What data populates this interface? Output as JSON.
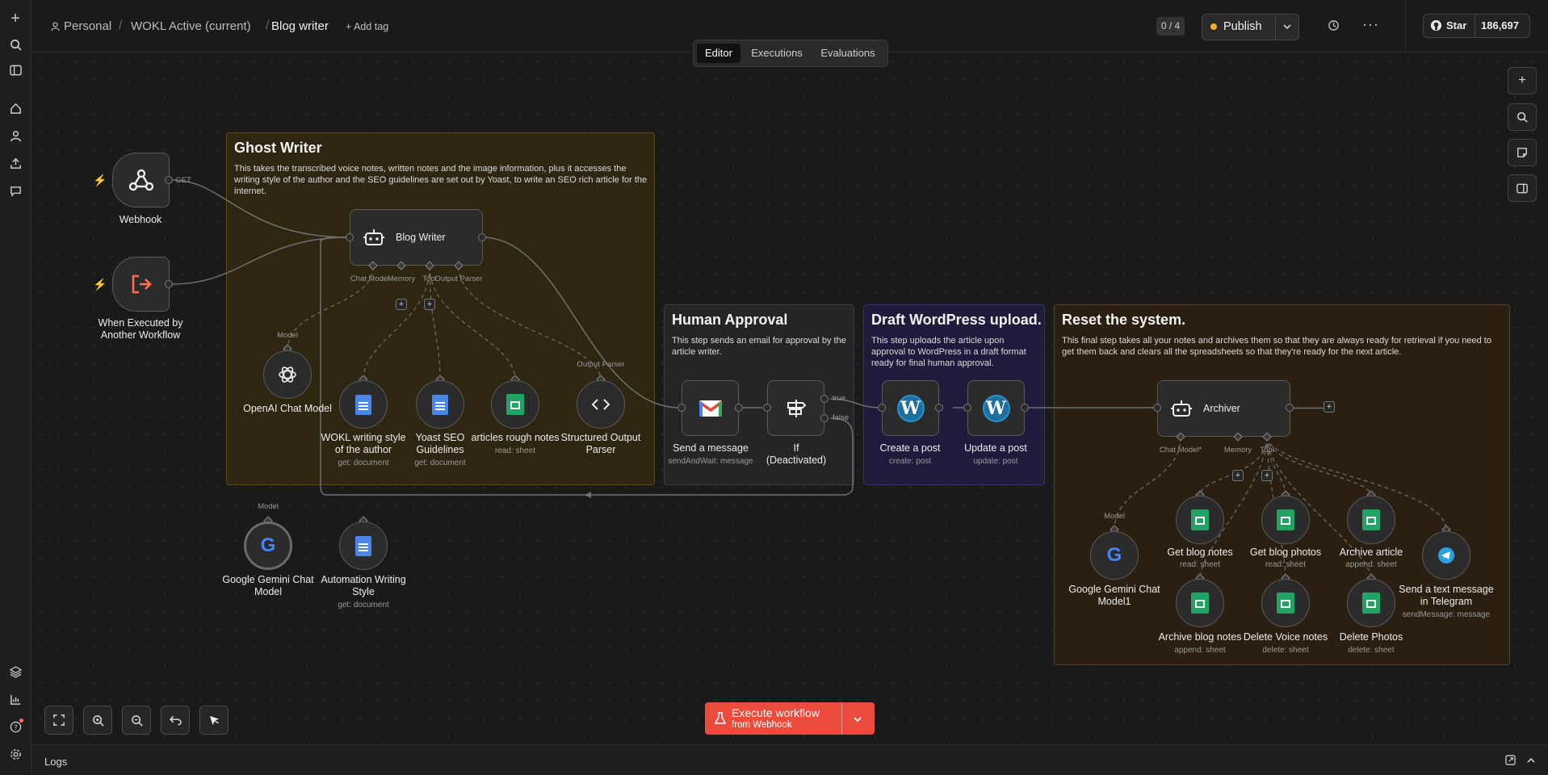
{
  "header": {
    "breadcrumb": [
      "Personal",
      "WOKL Active (current)",
      "Blog writer"
    ],
    "add_tag": "+ Add tag",
    "counter": "0 / 4",
    "publish": "Publish",
    "star_label": "Star",
    "star_count": "186,697"
  },
  "tabs": [
    "Editor",
    "Executions",
    "Evaluations"
  ],
  "sticky_notes": {
    "ghost": {
      "title": "Ghost Writer",
      "text": "This takes the transcribed voice notes, written notes and the image information, plus it accesses the writing style of the author and the SEO guidelines are set out by Yoast, to write an SEO rich article for the internet."
    },
    "human": {
      "title": "Human Approval",
      "text": "This step sends an email for approval by the article writer."
    },
    "wordpress": {
      "title": "Draft WordPress upload.",
      "text": "This step uploads the article upon approval to WordPress in a draft format ready for final human approval."
    },
    "reset": {
      "title": "Reset the system.",
      "text": "This final step takes all your notes and archives them so that they are always ready for retrieval if you need to get them back and clears all the spreadsheets so that they're ready for the next article."
    }
  },
  "nodes": {
    "webhook": {
      "label": "Webhook",
      "port": "GET"
    },
    "executed": {
      "label1": "When Executed by",
      "label2": "Another Workflow"
    },
    "blog_writer": {
      "label": "Blog Writer",
      "ports": [
        "Chat Model",
        "Memory",
        "Tool",
        "Output Parser"
      ]
    },
    "openai": {
      "label": "OpenAI Chat Model",
      "port": "Model"
    },
    "wokl": {
      "label1": "WOKL writing style",
      "label2": "of the author",
      "sub": "get: document"
    },
    "yoast": {
      "label1": "Yoast SEO",
      "label2": "Guidelines",
      "sub": "get: document"
    },
    "rough": {
      "label": "articles rough notes",
      "sub": "read: sheet"
    },
    "parser": {
      "label1": "Structured Output",
      "label2": "Parser",
      "port": "Output Parser"
    },
    "gemini": {
      "label1": "Google Gemini Chat",
      "label2": "Model",
      "port": "Model"
    },
    "automation": {
      "label1": "Automation Writing",
      "label2": "Style",
      "sub": "get: document"
    },
    "send_message": {
      "label": "Send a message",
      "sub": "sendAndWait: message"
    },
    "if_node": {
      "label1": "If",
      "label2": "(Deactivated)",
      "true": "true",
      "false": "false"
    },
    "create_post": {
      "label": "Create a post",
      "sub": "create: post"
    },
    "update_post": {
      "label": "Update a post",
      "sub": "update: post"
    },
    "archiver": {
      "label": "Archiver",
      "ports": [
        "Chat Model*",
        "Memory",
        "Tool"
      ]
    },
    "gemini1": {
      "label1": "Google Gemini Chat",
      "label2": "Model1",
      "port": "Model"
    },
    "get_notes": {
      "label": "Get blog notes",
      "sub": "read: sheet"
    },
    "get_photos": {
      "label": "Get blog photos",
      "sub": "read: sheet"
    },
    "archive_article": {
      "label": "Archive article",
      "sub": "append: sheet"
    },
    "telegram": {
      "label1": "Send a text message",
      "label2": "in Telegram",
      "sub": "sendMessage: message"
    },
    "archive_notes": {
      "label": "Archive blog notes",
      "sub": "append: sheet"
    },
    "delete_voice": {
      "label": "Delete Voice notes",
      "sub": "delete: sheet"
    },
    "delete_photos": {
      "label": "Delete Photos",
      "sub": "delete: sheet"
    }
  },
  "execute": {
    "title": "Execute workflow",
    "sub": "from Webhook"
  },
  "logs": "Logs",
  "colors": {
    "accent": "#ff6d5a",
    "execute": "#ea4b3c",
    "warning": "#f0b429"
  }
}
